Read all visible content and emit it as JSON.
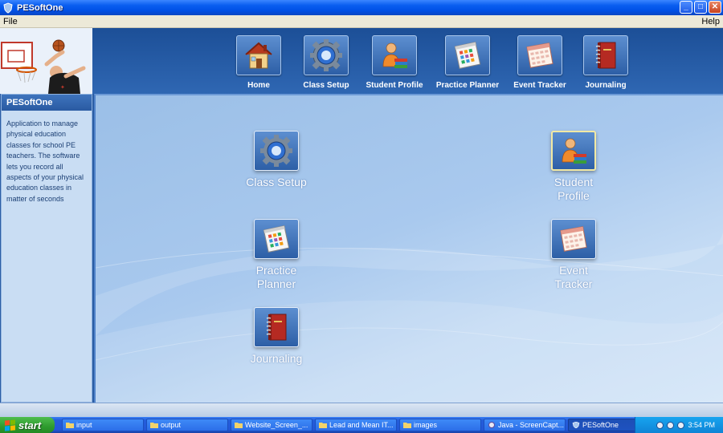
{
  "window": {
    "title": "PESoftOne",
    "minimize": "_",
    "maximize": "□",
    "close": "✕"
  },
  "menu": {
    "file": "File",
    "help": "Help"
  },
  "nav": [
    {
      "label": "Home",
      "icon": "home-icon"
    },
    {
      "label": "Class Setup",
      "icon": "gear-icon"
    },
    {
      "label": "Student Profile",
      "icon": "student-icon"
    },
    {
      "label": "Practice Planner",
      "icon": "planner-icon"
    },
    {
      "label": "Event Tracker",
      "icon": "calendar-icon"
    },
    {
      "label": "Journaling",
      "icon": "book-icon"
    }
  ],
  "sidebar": {
    "title": "PESoftOne",
    "description": "Application to manage physical education classes for school PE teachers.  The software lets you record all aspects of your physical education classes in matter of seconds"
  },
  "tiles": [
    {
      "label": "Class Setup",
      "icon": "gear-icon"
    },
    {
      "label": "Student Profile",
      "icon": "student-icon"
    },
    {
      "label": "Practice Planner",
      "icon": "planner-icon"
    },
    {
      "label": "Event Tracker",
      "icon": "calendar-icon"
    },
    {
      "label": "Journaling",
      "icon": "book-icon"
    }
  ],
  "taskbar": {
    "start": "start",
    "tasks": [
      "input",
      "output",
      "Website_Screen_...",
      "Lead and Mean IT...",
      "images",
      "Java - ScreenCapt...",
      "PESoftOne"
    ],
    "clock": "3:54 PM"
  }
}
